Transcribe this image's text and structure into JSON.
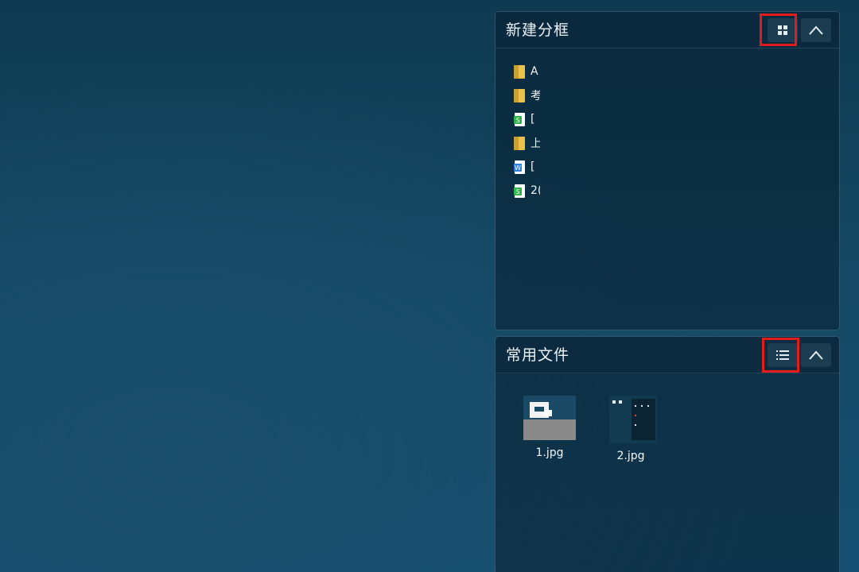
{
  "fences": [
    {
      "title": "新建分框",
      "view_mode": "icon-view-toggle",
      "items": [
        {
          "name": "A",
          "type": "folder",
          "icon": "folder-icon"
        },
        {
          "name": "考",
          "type": "folder",
          "icon": "folder-icon"
        },
        {
          "name": "[",
          "type": "spreadsheet",
          "icon": "spreadsheet-icon"
        },
        {
          "name": "上",
          "type": "folder",
          "icon": "folder-icon"
        },
        {
          "name": "[",
          "type": "document",
          "icon": "word-document-icon"
        },
        {
          "name": "2(",
          "type": "spreadsheet",
          "icon": "spreadsheet-icon"
        }
      ]
    },
    {
      "title": "常用文件",
      "view_mode": "list-view-toggle",
      "items": [
        {
          "name": "1.jpg",
          "type": "image",
          "icon": "image-thumbnail-icon"
        },
        {
          "name": "2.jpg",
          "type": "image",
          "icon": "image-thumbnail-icon"
        }
      ]
    }
  ],
  "colors": {
    "highlight": "#e21b1b",
    "folder": "#e8c24a",
    "spreadsheet": "#2fb34a",
    "document": "#2f7de0"
  }
}
